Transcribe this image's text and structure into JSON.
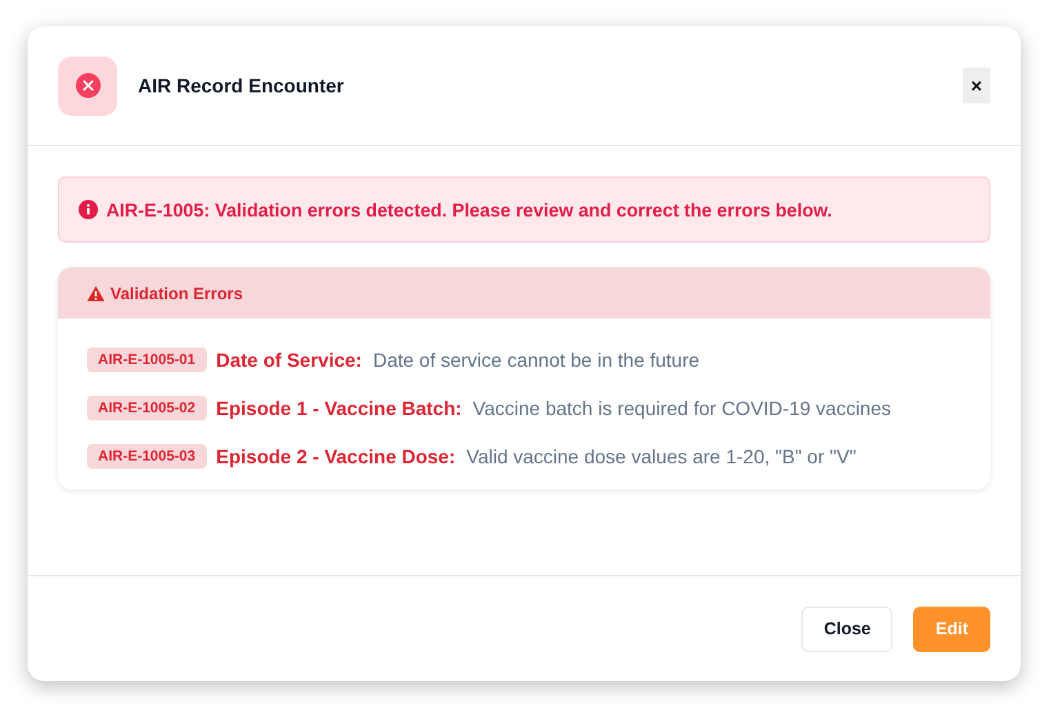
{
  "dialog": {
    "title": "AIR Record Encounter",
    "close_glyph": "×"
  },
  "alert": {
    "text": "AIR-E-1005: Validation errors detected. Please review and correct the errors below."
  },
  "errors_panel": {
    "title": "Validation Errors",
    "errors": [
      {
        "code": "AIR-E-1005-01",
        "field": "Date of Service:",
        "message": "Date of service cannot be in the future"
      },
      {
        "code": "AIR-E-1005-02",
        "field": "Episode 1 - Vaccine Batch:",
        "message": "Vaccine batch is required for COVID-19 vaccines"
      },
      {
        "code": "AIR-E-1005-03",
        "field": "Episode 2 - Vaccine Dose:",
        "message": "Valid vaccine dose values are 1-20, \"B\" or \"V\""
      }
    ]
  },
  "buttons": [
    {
      "label": "Close",
      "kind": "secondary"
    },
    {
      "label": "Edit",
      "kind": "primary"
    }
  ]
}
